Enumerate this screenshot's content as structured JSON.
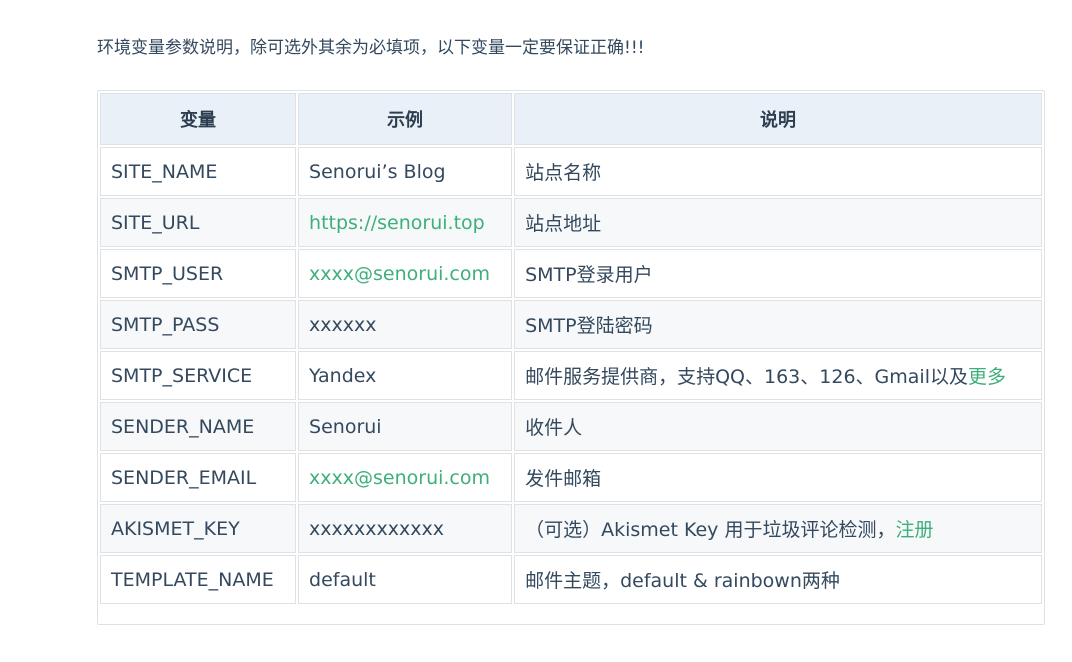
{
  "intro": "环境变量参数说明，除可选外其余为必填项，以下变量一定要保证正确!!!",
  "colors": {
    "link": "#3eaf7c",
    "header_bg": "#eaf0f8",
    "text": "#34495e"
  },
  "table": {
    "headers": [
      "变量",
      "示例",
      "说明"
    ],
    "rows": [
      {
        "var": "SITE_NAME",
        "example": "Senorui’s Blog",
        "desc": "站点名称"
      },
      {
        "var": "SITE_URL",
        "example": "https://senorui.top",
        "desc": "站点地址"
      },
      {
        "var": "SMTP_USER",
        "example": "xxxx@senorui.com",
        "desc": "SMTP登录用户"
      },
      {
        "var": "SMTP_PASS",
        "example": "xxxxxx",
        "desc": "SMTP登陆密码"
      },
      {
        "var": "SMTP_SERVICE",
        "example": "Yandex",
        "desc": "邮件服务提供商，支持QQ、163、126、Gmail以及",
        "desc_link": "更多"
      },
      {
        "var": "SENDER_NAME",
        "example": "Senorui",
        "desc": "收件人"
      },
      {
        "var": "SENDER_EMAIL",
        "example": "xxxx@senorui.com",
        "desc": "发件邮箱"
      },
      {
        "var": "AKISMET_KEY",
        "example": "xxxxxxxxxxxx",
        "desc": "（可选）Akismet Key 用于垃圾评论检测，",
        "desc_link": "注册"
      },
      {
        "var": "TEMPLATE_NAME",
        "example": "default",
        "desc": "邮件主题，default & rainbown两种"
      }
    ]
  }
}
